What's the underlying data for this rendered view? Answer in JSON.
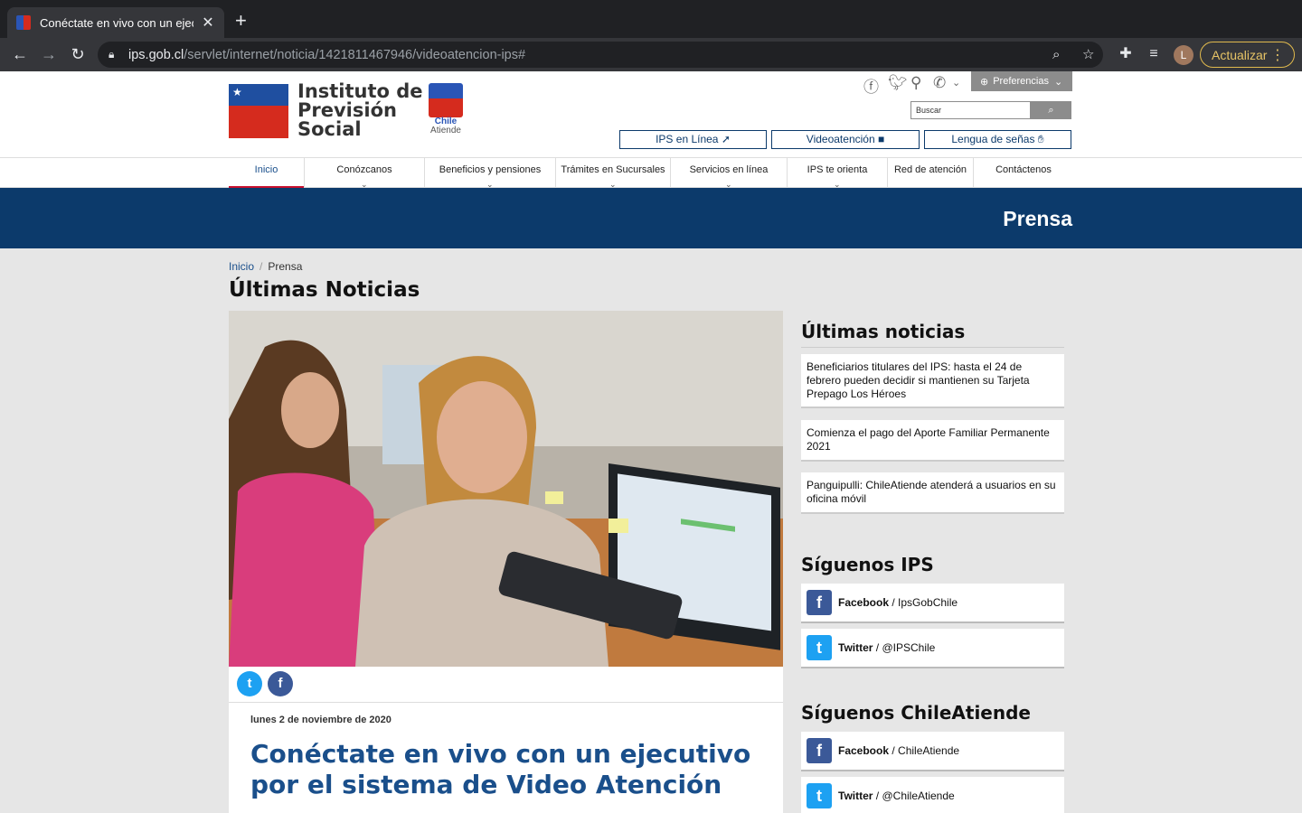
{
  "browser": {
    "tab_title": "Conéctate en vivo con un ejecu",
    "tab_close": "✕",
    "new_tab": "+",
    "url_host": "ips.gob.cl",
    "url_path": "/servlet/internet/noticia/1421811467946/videoatencion-ips#",
    "profile_initial": "L",
    "update_label": "Actualizar"
  },
  "header": {
    "logo_line1": "Instituto de",
    "logo_line2": "Previsión",
    "logo_line3": "Social",
    "chile_line1": "Chile",
    "chile_line2": "Atiende",
    "preferences_label": "Preferencias",
    "search_placeholder": "Buscar",
    "quick_links": [
      "IPS en Línea",
      "Videoatención",
      "Lengua de señas"
    ]
  },
  "nav": {
    "items": [
      "Inicio",
      "Conózcanos",
      "Beneficios y pensiones",
      "Trámites en Sucursales",
      "Servicios en línea",
      "IPS te orienta",
      "Red de atención",
      "Contáctenos"
    ]
  },
  "banner": {
    "title": "Prensa"
  },
  "breadcrumb": {
    "home": "Inicio",
    "separator": "/",
    "current": "Prensa"
  },
  "page_title": "Últimas Noticias",
  "article": {
    "date": "lunes 2 de noviembre de 2020",
    "title": "Conéctate en vivo con un ejecutivo por el sistema de Video Atención"
  },
  "sidebar": {
    "latest_heading": "Últimas noticias",
    "news": [
      "Beneficiarios titulares del IPS: hasta el 24 de febrero pueden decidir si mantienen su Tarjeta Prepago Los Héroes",
      "Comienza el pago del Aporte Familiar Permanente 2021",
      "Panguipulli: ChileAtiende atenderá a usuarios en su oficina móvil"
    ],
    "follow_ips_heading": "Síguenos IPS",
    "follow_ips": [
      {
        "network": "Facebook",
        "handle": "/ IpsGobChile"
      },
      {
        "network": "Twitter",
        "handle": "/ @IPSChile"
      }
    ],
    "follow_ca_heading": "Síguenos ChileAtiende",
    "follow_ca": [
      {
        "network": "Facebook",
        "handle": "/ ChileAtiende"
      },
      {
        "network": "Twitter",
        "handle": "/ @ChileAtiende"
      }
    ]
  },
  "colors": {
    "primary_blue": "#0c3a6b",
    "link_blue": "#1a4f8b",
    "accent_red": "#c8102e",
    "facebook": "#3b5998",
    "twitter": "#1da1f2"
  }
}
